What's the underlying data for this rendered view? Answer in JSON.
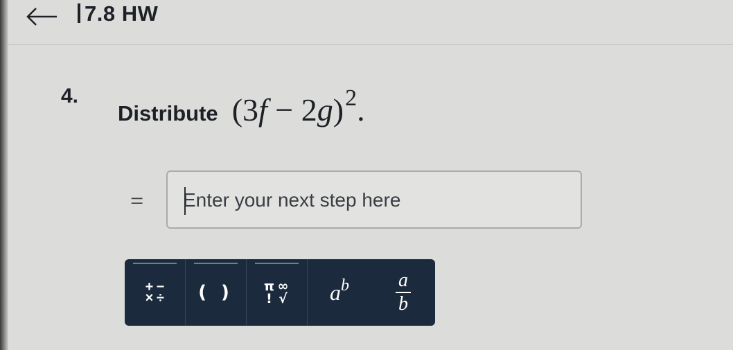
{
  "header": {
    "title": "7.8 HW",
    "back_icon": "arrow-left-icon"
  },
  "question": {
    "number": "4.",
    "instruction": "Distribute",
    "expression": {
      "open": "(",
      "c1": "3",
      "v1": "f",
      "op": " − ",
      "c2": "2",
      "v2": "g",
      "close": ")",
      "exponent": "2",
      "period": "."
    }
  },
  "answer": {
    "equals": "=",
    "placeholder": "Enter your next step here",
    "value": ""
  },
  "toolbar": {
    "ops": {
      "plus": "+",
      "minus": "−",
      "times": "×",
      "divide": "÷"
    },
    "parens": "( )",
    "symbols": {
      "pi": "π",
      "infinity": "∞",
      "factorial": "!",
      "sqrt": "√"
    },
    "power": {
      "base": "a",
      "exponent": "b"
    },
    "fraction": {
      "numerator": "a",
      "denominator": "b"
    }
  },
  "colors": {
    "background": "#dcdcdb",
    "toolbar": "#1c2a3d",
    "text": "#1d2126"
  }
}
